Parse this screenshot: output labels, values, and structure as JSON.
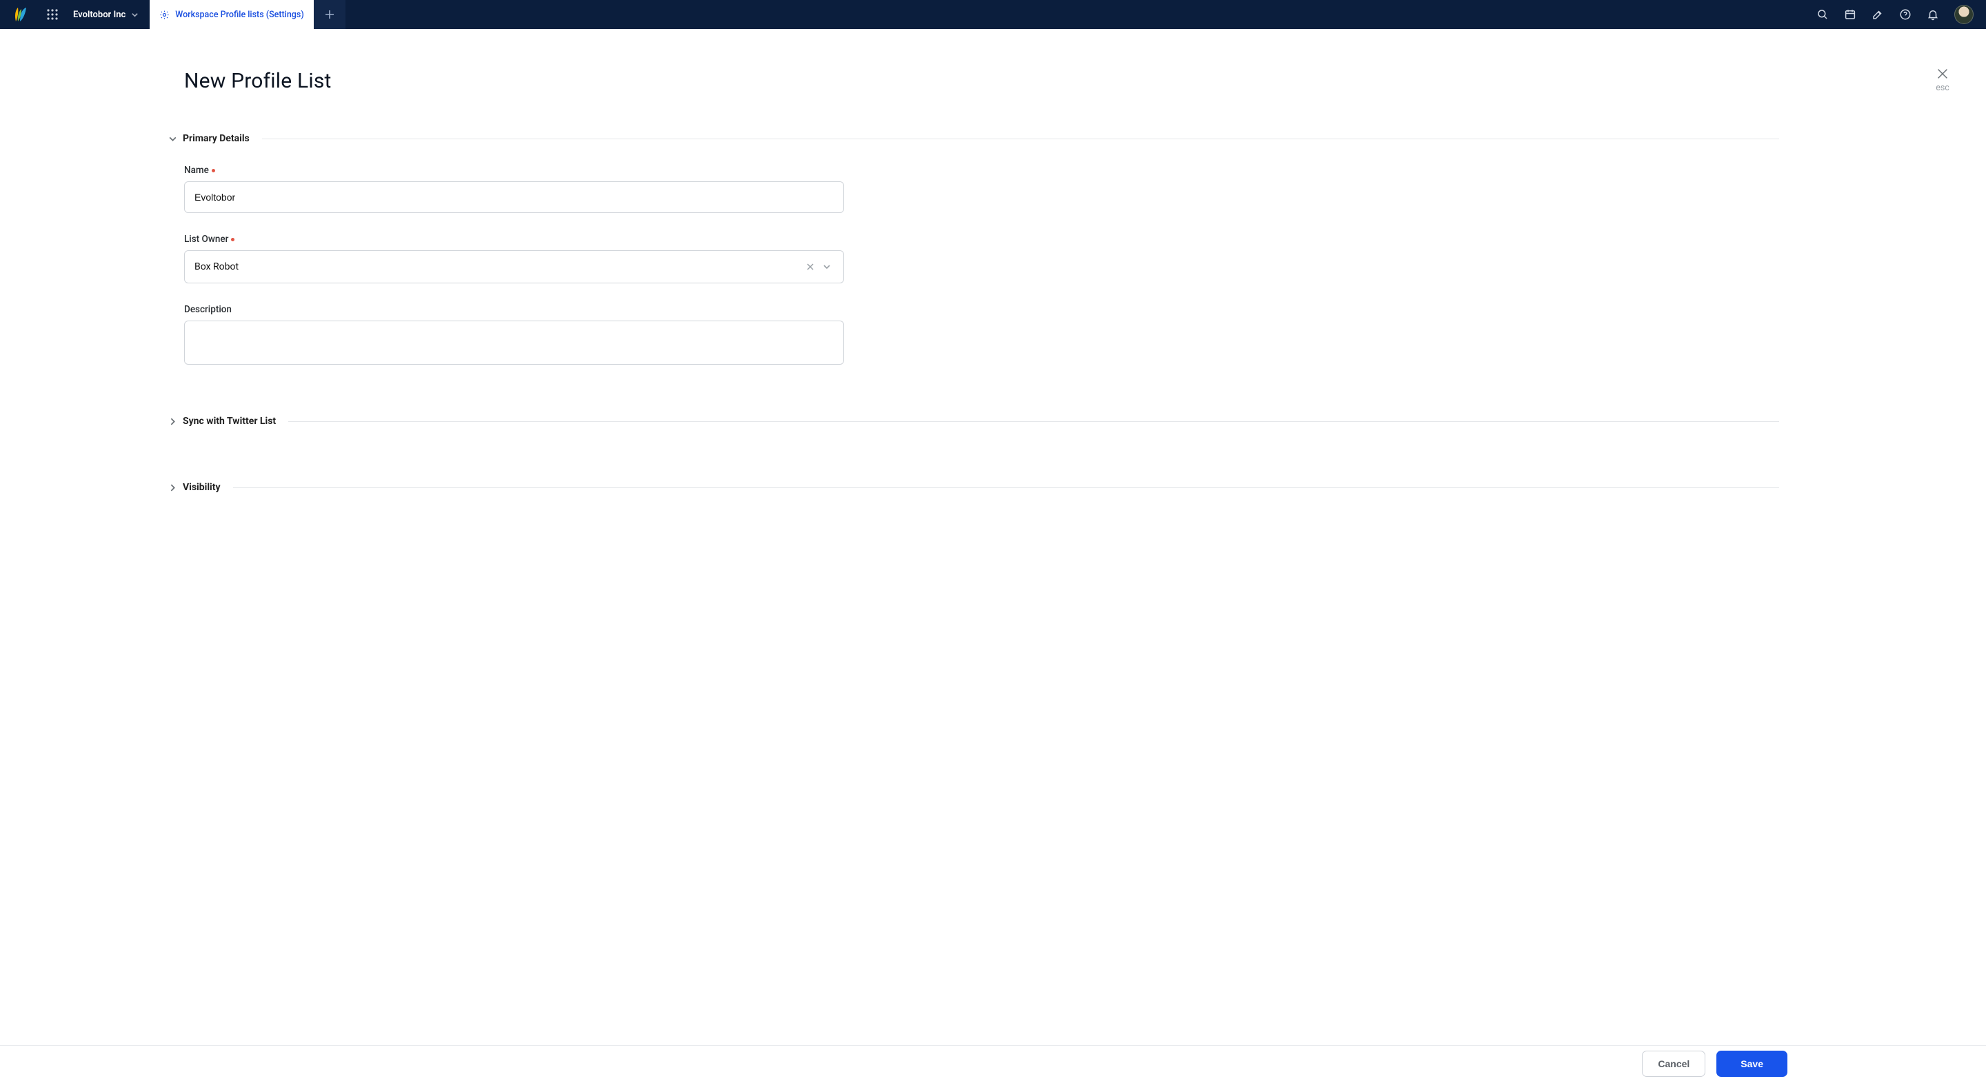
{
  "topbar": {
    "workspace_name": "Evoltobor Inc",
    "active_tab_label": "Workspace Profile lists (Settings)"
  },
  "page": {
    "title": "New Profile List",
    "close_esc_label": "esc"
  },
  "sections": {
    "primary_details": {
      "title": "Primary Details",
      "fields": {
        "name": {
          "label": "Name",
          "value": "Evoltobor",
          "required": true
        },
        "list_owner": {
          "label": "List Owner",
          "value": "Box Robot",
          "required": true
        },
        "description": {
          "label": "Description",
          "value": "",
          "required": false
        }
      }
    },
    "sync_twitter": {
      "title": "Sync with Twitter List"
    },
    "visibility": {
      "title": "Visibility"
    }
  },
  "footer": {
    "cancel_label": "Cancel",
    "save_label": "Save"
  }
}
